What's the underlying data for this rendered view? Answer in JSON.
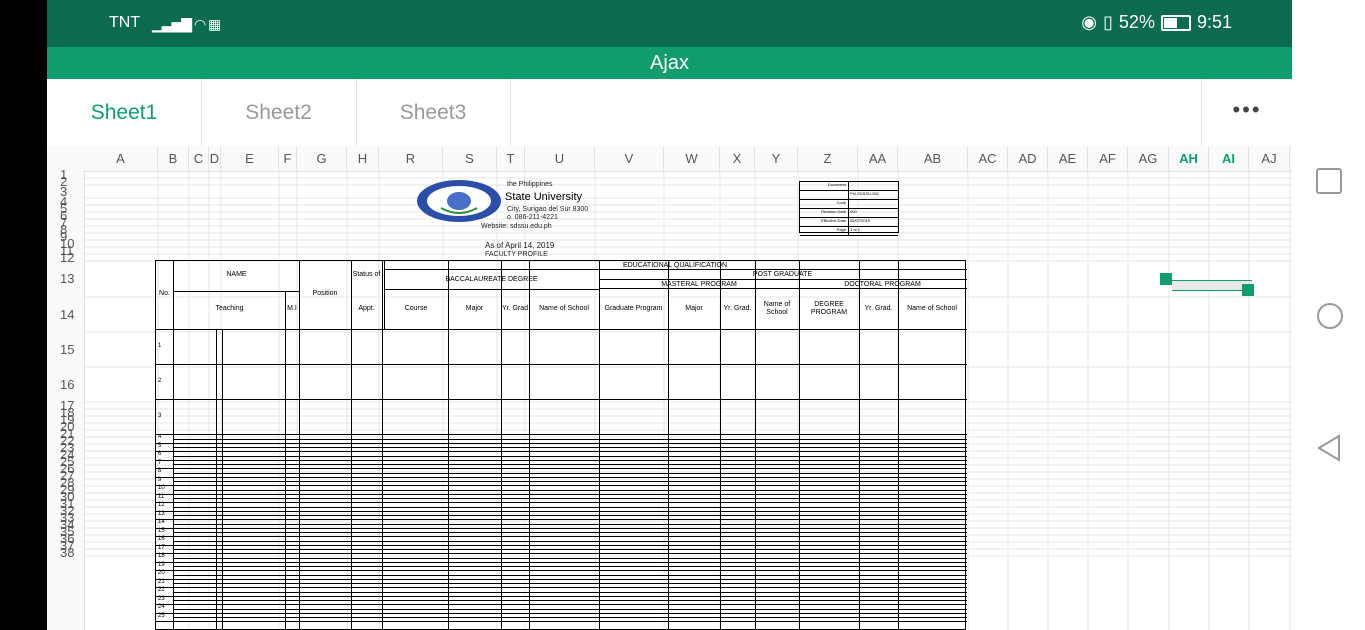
{
  "status": {
    "carrier": "TNT",
    "battery": "52%",
    "time": "9:51"
  },
  "app": {
    "title": "Ajax"
  },
  "tabs": [
    {
      "label": "Sheet1"
    },
    {
      "label": "Sheet2"
    },
    {
      "label": "Sheet3"
    }
  ],
  "more_label": "•••",
  "columns": [
    "A",
    "B",
    "C",
    "D",
    "E",
    "F",
    "G",
    "H",
    "R",
    "S",
    "T",
    "U",
    "V",
    "W",
    "X",
    "Y",
    "Z",
    "AA",
    "AB",
    "AC",
    "AD",
    "AE",
    "AF",
    "AG",
    "AH",
    "AI",
    "AJ"
  ],
  "selected_columns": [
    "AH",
    "AI"
  ],
  "rows": [
    "1",
    "2",
    "3",
    "4",
    "5",
    "6",
    "7",
    "8",
    "9",
    "10",
    "11",
    "12",
    "13",
    "14",
    "15",
    "16",
    "17",
    "18",
    "19",
    "20",
    "21",
    "22",
    "23",
    "24",
    "25",
    "26",
    "27",
    "28",
    "29",
    "30",
    "31",
    "32",
    "33",
    "34",
    "35",
    "36",
    "37",
    "38"
  ],
  "document": {
    "header_line1": "the Philippines",
    "university": "State University",
    "address": "City, Surigao del Sur 8300",
    "phone": "o. 086-211-4221",
    "website": "Website: sdssu.edu.ph",
    "as_of": "As of April 14, 2019",
    "title": "FACULTY PROFILE",
    "docbox": [
      [
        "Document",
        ""
      ],
      [
        "",
        "FM-SDSSU-052"
      ],
      [
        "Code",
        ""
      ],
      [
        "Revision Date",
        "000"
      ],
      [
        "Effective Date",
        "06/07/2019"
      ],
      [
        "Page",
        "1 of 1"
      ]
    ]
  },
  "table": {
    "edu_qual": "EDUCATIONAL QUALIFICATION",
    "name": "NAME",
    "status_of": "Status of",
    "position": "Position",
    "no": "No.",
    "bacc": "BACCALAUREATE DEGREE",
    "post_grad": "POST GRADUATE",
    "masteral": "MASTERAL PROGRAM",
    "doctoral": "DOCTORAL PROGRAM",
    "teaching": "Teaching",
    "mi": "M.I",
    "appt": "Appt.",
    "course": "Course",
    "major": "Major",
    "yr_grad": "Yr. Grad",
    "name_school": "Name of School",
    "grad_program": "Graduate Program",
    "major2": "Major",
    "yr_grad2": "Yr. Grad.",
    "name_school2": "Name of School",
    "degree_program": "DEGREE PROGRAM",
    "yr_grad3": "Yr. Grad.",
    "name_school3": "Name of School",
    "row_numbers": [
      "1",
      "2",
      "3",
      "4",
      "5",
      "6",
      "7",
      "8",
      "9",
      "10",
      "11",
      "12",
      "13",
      "14",
      "15",
      "16",
      "17",
      "18",
      "19",
      "20",
      "21",
      "22",
      "23",
      "24",
      "25"
    ]
  }
}
